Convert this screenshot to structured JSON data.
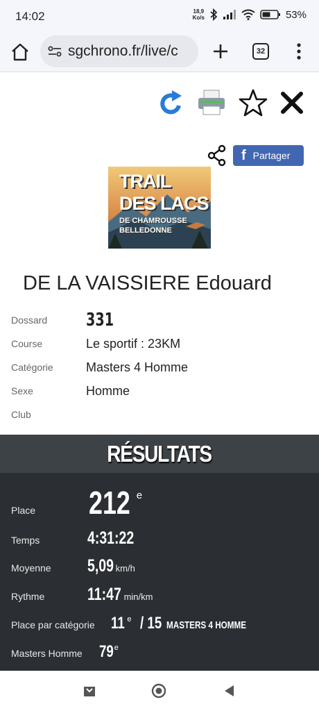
{
  "status": {
    "time": "14:02",
    "net_speed_top": "18,9",
    "net_speed_bottom": "Ko/s",
    "battery": "53%"
  },
  "browser": {
    "url": "sgchrono.fr/live/c",
    "tab_count": "32"
  },
  "toolbar": {
    "share_label": "Partager",
    "facebook_letter": "f"
  },
  "logo": {
    "line1": "TRAIL",
    "line2": "DES LACS",
    "line3": "DE CHAMROUSSE",
    "line4": "BELLEDONNE"
  },
  "athlete": {
    "name": "DE LA VAISSIERE Edouard",
    "fields": [
      {
        "label": "Dossard",
        "value": "331"
      },
      {
        "label": "Course",
        "value": "Le sportif : 23KM"
      },
      {
        "label": "Catégorie",
        "value": "Masters 4 Homme"
      },
      {
        "label": "Sexe",
        "value": "Homme"
      },
      {
        "label": "Club",
        "value": ""
      }
    ]
  },
  "results": {
    "title": "RÉSULTATS",
    "place_label": "Place",
    "place_value": "212",
    "place_sup": "e",
    "time_label": "Temps",
    "time_value": "4:31:22",
    "avg_label": "Moyenne",
    "avg_value": "5,09",
    "avg_unit": "km/h",
    "pace_label": "Rythme",
    "pace_value": "11:47",
    "pace_unit": "min/km",
    "cat_label": "Place par catégorie",
    "cat_value": "11",
    "cat_sup": "e",
    "cat_total": "/ 15",
    "cat_name": "MASTERS 4 HOMME",
    "masters_label": "Masters Homme",
    "masters_value": "79",
    "masters_sup": "e"
  }
}
